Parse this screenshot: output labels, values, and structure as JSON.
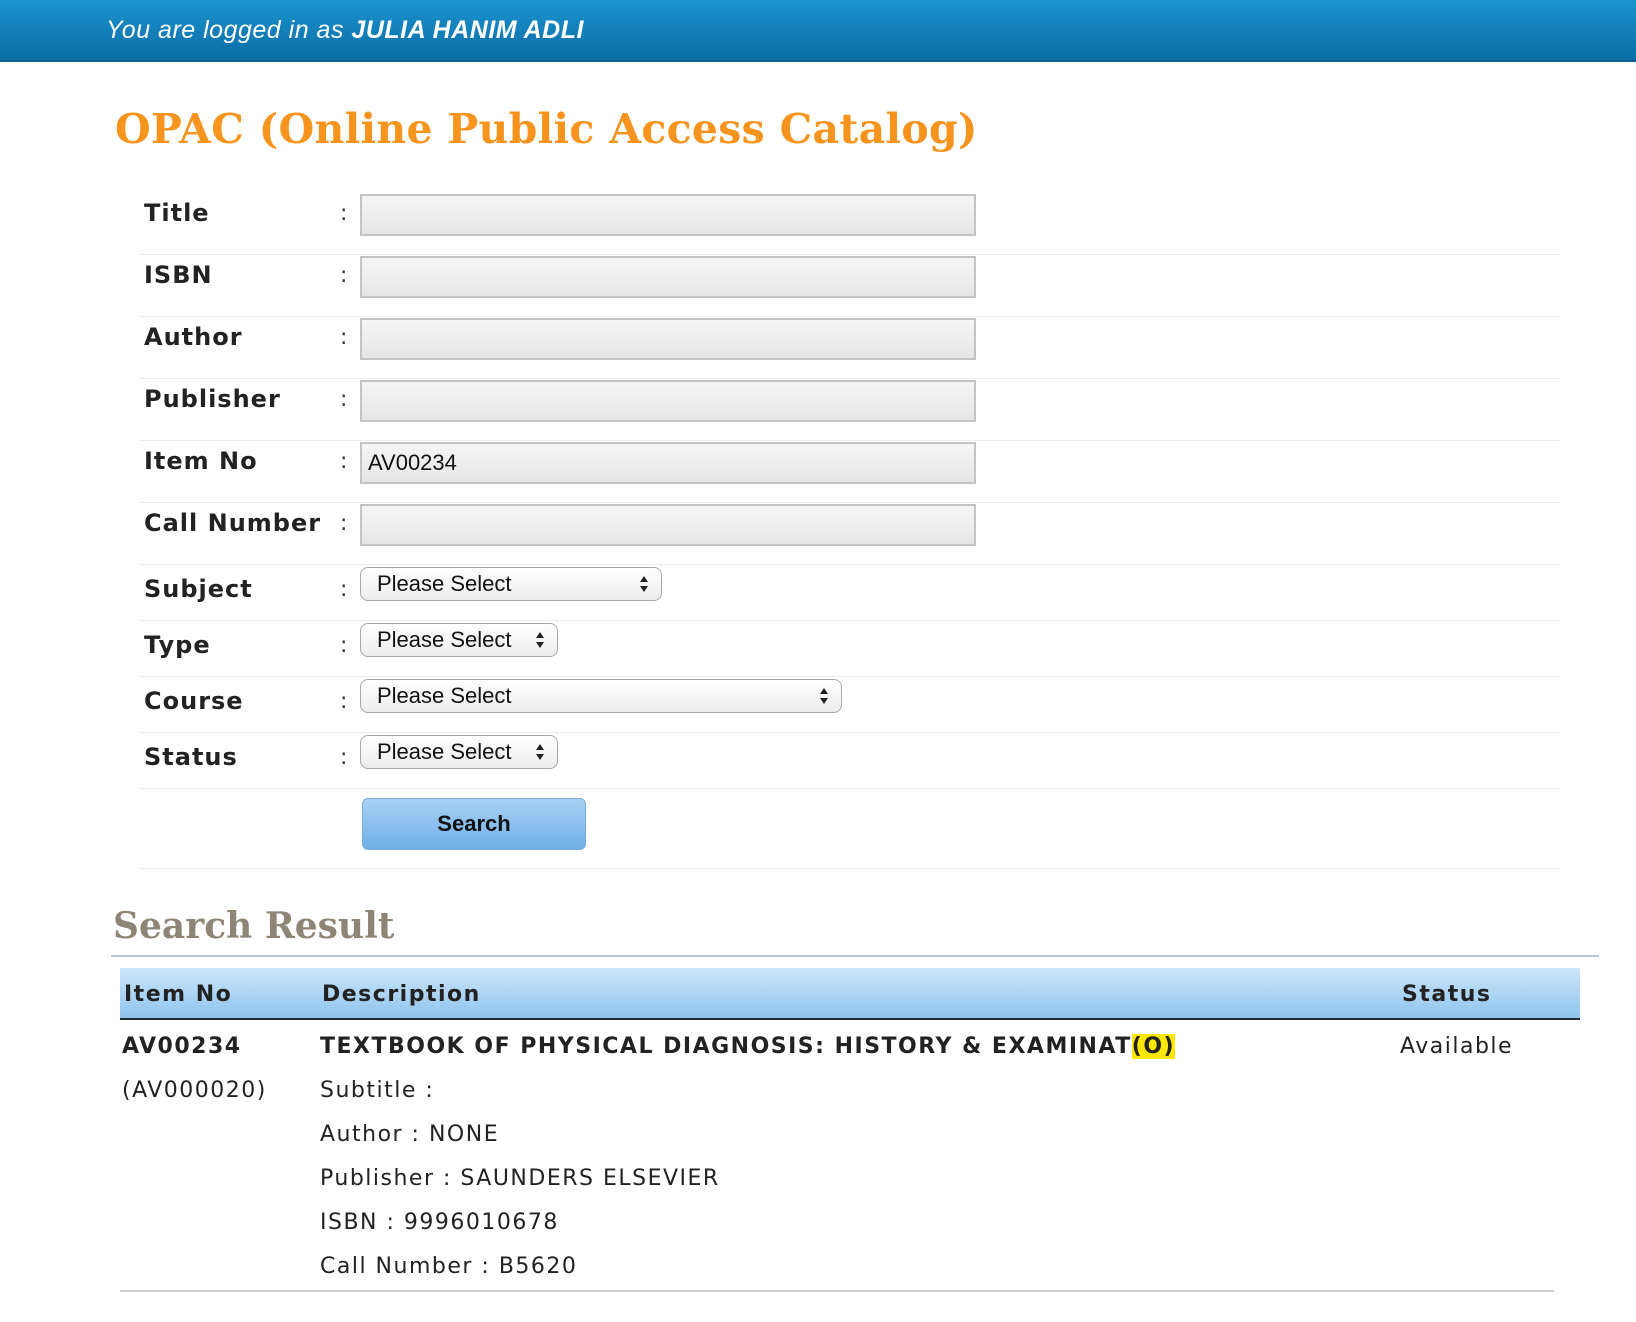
{
  "header": {
    "login_prefix": "You are logged in as",
    "user_name": "JULIA HANIM ADLI"
  },
  "page": {
    "title": "OPAC (Online Public Access Catalog)"
  },
  "form": {
    "colon": ":",
    "title": {
      "label": "Title",
      "value": ""
    },
    "isbn": {
      "label": "ISBN",
      "value": ""
    },
    "author": {
      "label": "Author",
      "value": ""
    },
    "publisher": {
      "label": "Publisher",
      "value": ""
    },
    "item_no": {
      "label": "Item No",
      "value": "AV00234"
    },
    "call_number": {
      "label": "Call Number",
      "value": ""
    },
    "subject": {
      "label": "Subject",
      "selected": "Please Select"
    },
    "type": {
      "label": "Type",
      "selected": "Please Select"
    },
    "course": {
      "label": "Course",
      "selected": "Please Select"
    },
    "status": {
      "label": "Status",
      "selected": "Please Select"
    },
    "search_button": "Search"
  },
  "results": {
    "heading": "Search Result",
    "columns": {
      "item_no": "Item No",
      "description": "Description",
      "status": "Status"
    },
    "rows": [
      {
        "item_no": "AV00234",
        "item_sub": "(AV000020)",
        "title": "TEXTBOOK OF PHYSICAL DIAGNOSIS: HISTORY & EXAMINAT",
        "title_highlight": "(O)",
        "subtitle": "Subtitle :",
        "author": "Author : NONE",
        "publisher": "Publisher : SAUNDERS ELSEVIER",
        "isbn": "ISBN : 9996010678",
        "call_number": "Call Number : B5620",
        "status": "Available"
      }
    ]
  },
  "colors": {
    "header_bar": "#0a6ca5",
    "title_orange": "#f7941e",
    "result_heading": "#8e8577",
    "table_header": "#8fc4ee",
    "highlight": "#ffe800"
  },
  "icons": {
    "select_arrow": "up-down-arrows-icon"
  }
}
